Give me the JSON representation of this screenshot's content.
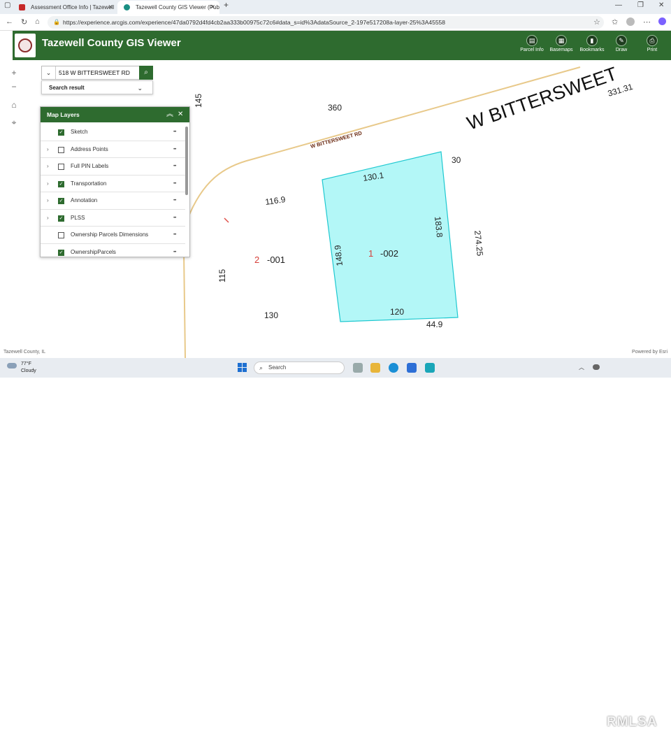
{
  "browser": {
    "tabs": [
      {
        "title": "Assessment Office Info | Tazewell"
      },
      {
        "title": "Tazewell County GIS Viewer (Publ"
      }
    ],
    "new_tab": "+",
    "url": "https://experience.arcgis.com/experience/47da0792d4fd4cb2aa333b00975c72c6#data_s=id%3AdataSource_2-197e517208a-layer-25%3A45558"
  },
  "app": {
    "title": "Tazewell County GIS Viewer",
    "tools": [
      {
        "label": "Parcel Info",
        "icon": "parcel-info-icon"
      },
      {
        "label": "Basemaps",
        "icon": "basemaps-icon"
      },
      {
        "label": "Bookmarks",
        "icon": "bookmarks-icon"
      },
      {
        "label": "Draw",
        "icon": "draw-icon"
      },
      {
        "label": "Print",
        "icon": "print-icon"
      }
    ]
  },
  "map_controls": {
    "zoom_in": "+",
    "zoom_out": "−",
    "home": "⌂",
    "locate": "⌖"
  },
  "search": {
    "value": "518 W BITTERSWEET RD",
    "result_label": "Search result"
  },
  "layers": {
    "title": "Map Layers",
    "items": [
      {
        "name": "Sketch",
        "checked": true,
        "expandable": false
      },
      {
        "name": "Address Points",
        "checked": false,
        "expandable": true
      },
      {
        "name": "Full PIN Labels",
        "checked": false,
        "expandable": true
      },
      {
        "name": "Transportation",
        "checked": true,
        "expandable": true
      },
      {
        "name": "Annotation",
        "checked": true,
        "expandable": true
      },
      {
        "name": "PLSS",
        "checked": true,
        "expandable": true
      },
      {
        "name": "Ownership Parcels Dimensions",
        "checked": false,
        "expandable": false
      },
      {
        "name": "OwnershipParcels",
        "checked": true,
        "expandable": false
      }
    ]
  },
  "map_labels": {
    "road_big": "W BITTERSWEET",
    "road_small": "W BITTERSWEET RD",
    "dims": [
      "145",
      "360",
      "331.31",
      "30",
      "130.1",
      "116.9",
      "183.8",
      "274.25",
      "148.9",
      "115",
      "130",
      "120",
      "44.9"
    ],
    "parcel_num_a": "2",
    "parcel_suffix_a": "-001",
    "parcel_num_b": "1",
    "parcel_suffix_b": "-002"
  },
  "attribution": {
    "left": "Tazewell County, IL",
    "right": "Powered by Esri"
  },
  "taskbar": {
    "temp": "77°F",
    "condition": "Cloudy",
    "search_placeholder": "Search",
    "watermark": "RMLSA"
  },
  "colors": {
    "header_green": "#2e6b2f",
    "parcel_fill": "#b3f7f7",
    "parcel_stroke": "#1fc8d0",
    "road": "#e8c98a"
  }
}
